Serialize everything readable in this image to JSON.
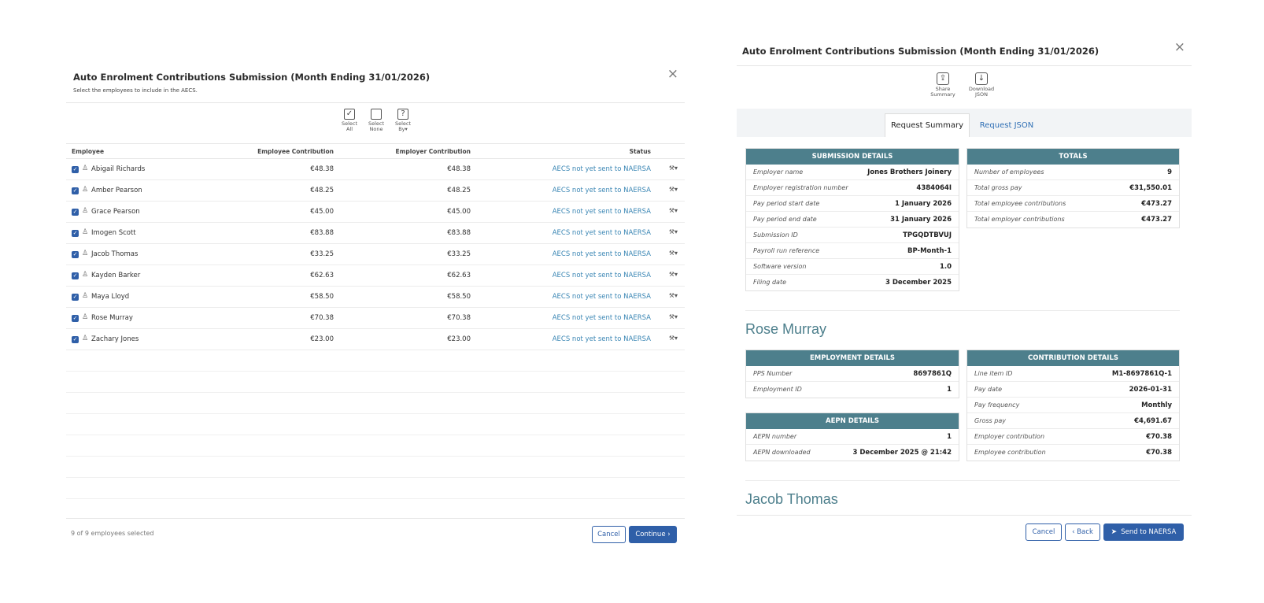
{
  "left": {
    "title": "Auto Enrolment Contributions Submission (Month Ending 31/01/2026)",
    "subtitle": "Select the employees to include in the AECS.",
    "close_glyph": "×",
    "select_all": {
      "icon": "check-box-icon",
      "glyph": "✓",
      "label1": "Select",
      "label2": "All"
    },
    "select_none": {
      "icon": "empty-box-icon",
      "glyph": "",
      "label1": "Select",
      "label2": "None"
    },
    "select_by": {
      "icon": "question-box-icon",
      "glyph": "?",
      "label1": "Select",
      "label2": "By▾"
    },
    "columns": {
      "employee": "Employee",
      "employee_contribution": "Employee Contribution",
      "employer_contribution": "Employer Contribution",
      "status": "Status"
    },
    "rows": [
      {
        "name": "Abigail Richards",
        "ec": "€48.38",
        "erc": "€48.38",
        "status": "AECS not yet sent to NAERSA"
      },
      {
        "name": "Amber Pearson",
        "ec": "€48.25",
        "erc": "€48.25",
        "status": "AECS not yet sent to NAERSA"
      },
      {
        "name": "Grace Pearson",
        "ec": "€45.00",
        "erc": "€45.00",
        "status": "AECS not yet sent to NAERSA"
      },
      {
        "name": "Imogen Scott",
        "ec": "€83.88",
        "erc": "€83.88",
        "status": "AECS not yet sent to NAERSA"
      },
      {
        "name": "Jacob Thomas",
        "ec": "€33.25",
        "erc": "€33.25",
        "status": "AECS not yet sent to NAERSA"
      },
      {
        "name": "Kayden Barker",
        "ec": "€62.63",
        "erc": "€62.63",
        "status": "AECS not yet sent to NAERSA"
      },
      {
        "name": "Maya Lloyd",
        "ec": "€58.50",
        "erc": "€58.50",
        "status": "AECS not yet sent to NAERSA"
      },
      {
        "name": "Rose Murray",
        "ec": "€70.38",
        "erc": "€70.38",
        "status": "AECS not yet sent to NAERSA"
      },
      {
        "name": "Zachary Jones",
        "ec": "€23.00",
        "erc": "€23.00",
        "status": "AECS not yet sent to NAERSA"
      }
    ],
    "footer_text": "9 of 9 employees selected",
    "cancel_label": "Cancel",
    "continue_label": "Continue ›"
  },
  "right": {
    "title": "Auto Enrolment Contributions Submission (Month Ending 31/01/2026)",
    "close_glyph": "×",
    "share": {
      "icon": "share-icon",
      "glyph": "⇪",
      "label1": "Share",
      "label2": "Summary"
    },
    "download": {
      "icon": "download-icon",
      "glyph": "↓",
      "label1": "Download",
      "label2": "JSON"
    },
    "tabs": {
      "summary": "Request Summary",
      "json": "Request JSON"
    },
    "submission": {
      "header": "SUBMISSION DETAILS",
      "rows": [
        {
          "k": "Employer name",
          "v": "Jones Brothers Joinery"
        },
        {
          "k": "Employer registration number",
          "v": "4384064I"
        },
        {
          "k": "Pay period start date",
          "v": "1 January 2026"
        },
        {
          "k": "Pay period end date",
          "v": "31 January 2026"
        },
        {
          "k": "Submission ID",
          "v": "TPGQDTBVUJ"
        },
        {
          "k": "Payroll run reference",
          "v": "BP-Month-1"
        },
        {
          "k": "Software version",
          "v": "1.0"
        },
        {
          "k": "Filing date",
          "v": "3 December 2025"
        }
      ]
    },
    "totals": {
      "header": "TOTALS",
      "rows": [
        {
          "k": "Number of employees",
          "v": "9"
        },
        {
          "k": "Total gross pay",
          "v": "€31,550.01"
        },
        {
          "k": "Total employee contributions",
          "v": "€473.27"
        },
        {
          "k": "Total employer contributions",
          "v": "€473.27"
        }
      ]
    },
    "person1": "Rose Murray",
    "employment": {
      "header": "EMPLOYMENT DETAILS",
      "rows": [
        {
          "k": "PPS Number",
          "v": "8697861Q"
        },
        {
          "k": "Employment ID",
          "v": "1"
        }
      ]
    },
    "aepn": {
      "header": "AEPN DETAILS",
      "rows": [
        {
          "k": "AEPN number",
          "v": "1"
        },
        {
          "k": "AEPN downloaded",
          "v": "3 December 2025 @ 21:42"
        }
      ]
    },
    "contribution": {
      "header": "CONTRIBUTION DETAILS",
      "rows": [
        {
          "k": "Line item ID",
          "v": "M1-8697861Q-1"
        },
        {
          "k": "Pay date",
          "v": "2026-01-31"
        },
        {
          "k": "Pay frequency",
          "v": "Monthly"
        },
        {
          "k": "Gross pay",
          "v": "€4,691.67"
        },
        {
          "k": "Employer contribution",
          "v": "€70.38"
        },
        {
          "k": "Employee contribution",
          "v": "€70.38"
        }
      ]
    },
    "person2": "Jacob Thomas",
    "cancel_label": "Cancel",
    "back_label": "‹ Back",
    "send_label": "Send to NAERSA",
    "send_icon": "paper-plane-icon"
  },
  "colors": {
    "accent": "#2f5fa8",
    "link": "#3a86b4",
    "teal_header": "#4d7f8c"
  }
}
